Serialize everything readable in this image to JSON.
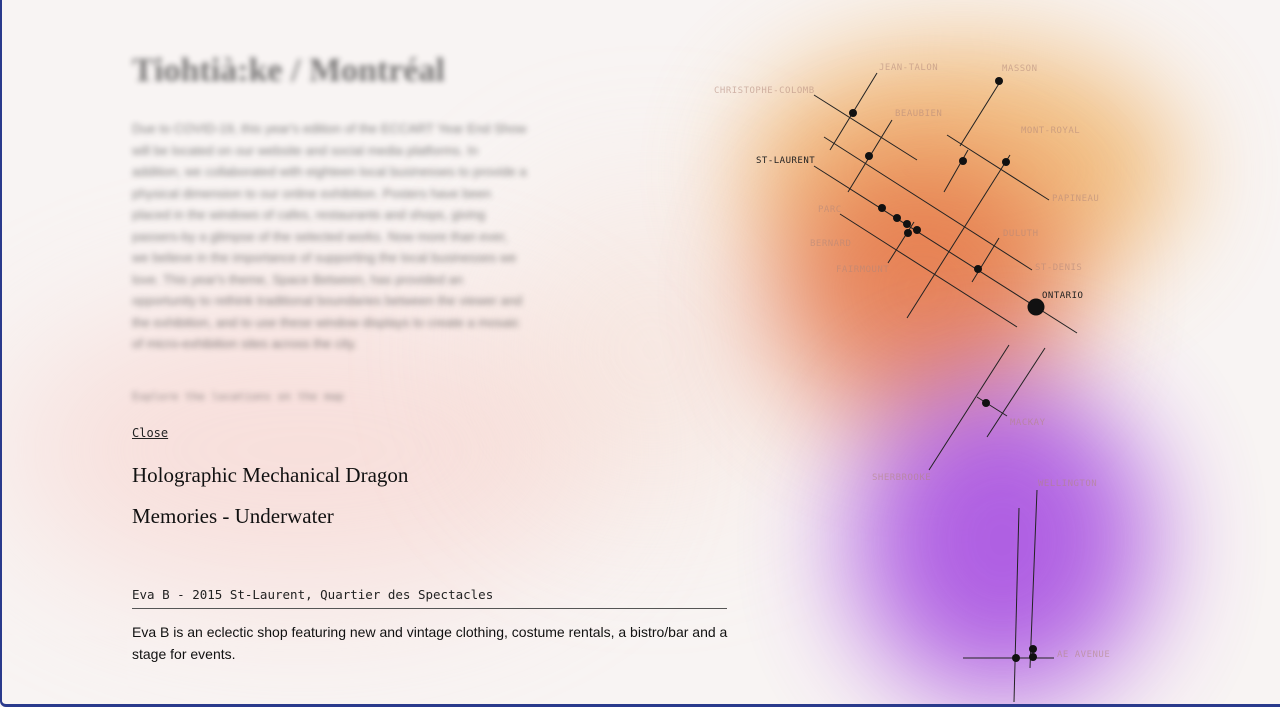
{
  "page": {
    "title": "Tiohtià:ke / Montréal",
    "intro": "Due to COVID-19, this year's edition of the ECCART Year End Show will be located on our website and social media platforms. In addition, we collaborated with eighteen local businesses to provide a physical dimension to our online exhibition. Posters have been placed in the windows of cafes, restaurants and shops, giving passers-by a glimpse of the selected works. Now more than ever, we believe in the importance of supporting the local businesses we love. This year's theme, Space Between, has provided an opportunity to rethink traditional boundaries between the viewer and the exhibition, and to use these window displays to create a mosaic of micro-exhibition sites across the city.",
    "explore": "Explore the locations on the map"
  },
  "close_label": "Close",
  "artworks": [
    "Holographic Mechanical Dragon",
    "Memories - Underwater"
  ],
  "venue": {
    "heading": "Eva B - 2015 St-Laurent, Quartier des Spectacles",
    "description": "Eva B is an eclectic shop featuring new and vintage clothing, costume rentals, a bistro/bar and a stage for events."
  },
  "map": {
    "streets": [
      "JEAN-TALON",
      "MASSON",
      "CHRISTOPHE-COLOMB",
      "BEAUBIEN",
      "MONT-ROYAL",
      "ST-LAURENT",
      "PAPINEAU",
      "PARC",
      "DULUTH",
      "BERNARD",
      "ST-DENIS",
      "FAIRMOUNT",
      "ONTARIO",
      "MACKAY",
      "SHERBROOKE",
      "WELLINGTON",
      "AE AVENUE"
    ]
  },
  "colors": {
    "frame": "#2a3a8c",
    "blob_orange": "#f0b060",
    "blob_red": "#e2683c",
    "blob_purple": "#a346e0"
  }
}
